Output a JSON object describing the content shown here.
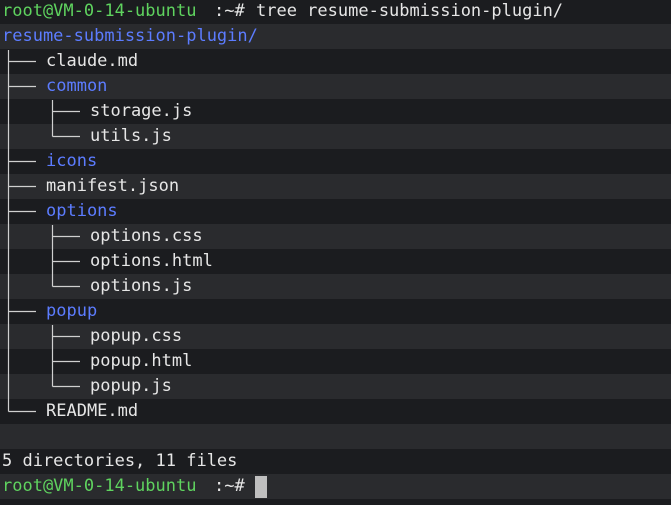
{
  "prompt": {
    "user_host": "root@VM-0-14-ubuntu",
    "path_sep": ":~#",
    "command": "tree resume-submission-plugin/"
  },
  "tree": {
    "root": "resume-submission-plugin/",
    "entries": [
      {
        "label": "claude.md",
        "type": "file"
      },
      {
        "label": "common",
        "type": "dir"
      },
      {
        "label": "storage.js",
        "type": "file"
      },
      {
        "label": "utils.js",
        "type": "file"
      },
      {
        "label": "icons",
        "type": "dir"
      },
      {
        "label": "manifest.json",
        "type": "file"
      },
      {
        "label": "options",
        "type": "dir"
      },
      {
        "label": "options.css",
        "type": "file"
      },
      {
        "label": "options.html",
        "type": "file"
      },
      {
        "label": "options.js",
        "type": "file"
      },
      {
        "label": "popup",
        "type": "dir"
      },
      {
        "label": "popup.css",
        "type": "file"
      },
      {
        "label": "popup.html",
        "type": "file"
      },
      {
        "label": "popup.js",
        "type": "file"
      },
      {
        "label": "README.md",
        "type": "file"
      }
    ]
  },
  "summary": "5 directories, 11 files",
  "prompt2": {
    "user_host": "root@VM-0-14-ubuntu",
    "path_sep": ":~#"
  },
  "colors": {
    "background": "#1b1c1f",
    "alt_row": "#2a2b2e",
    "prompt": "#5fd35f",
    "directory": "#5c7cff",
    "text": "#e6e6e6"
  }
}
